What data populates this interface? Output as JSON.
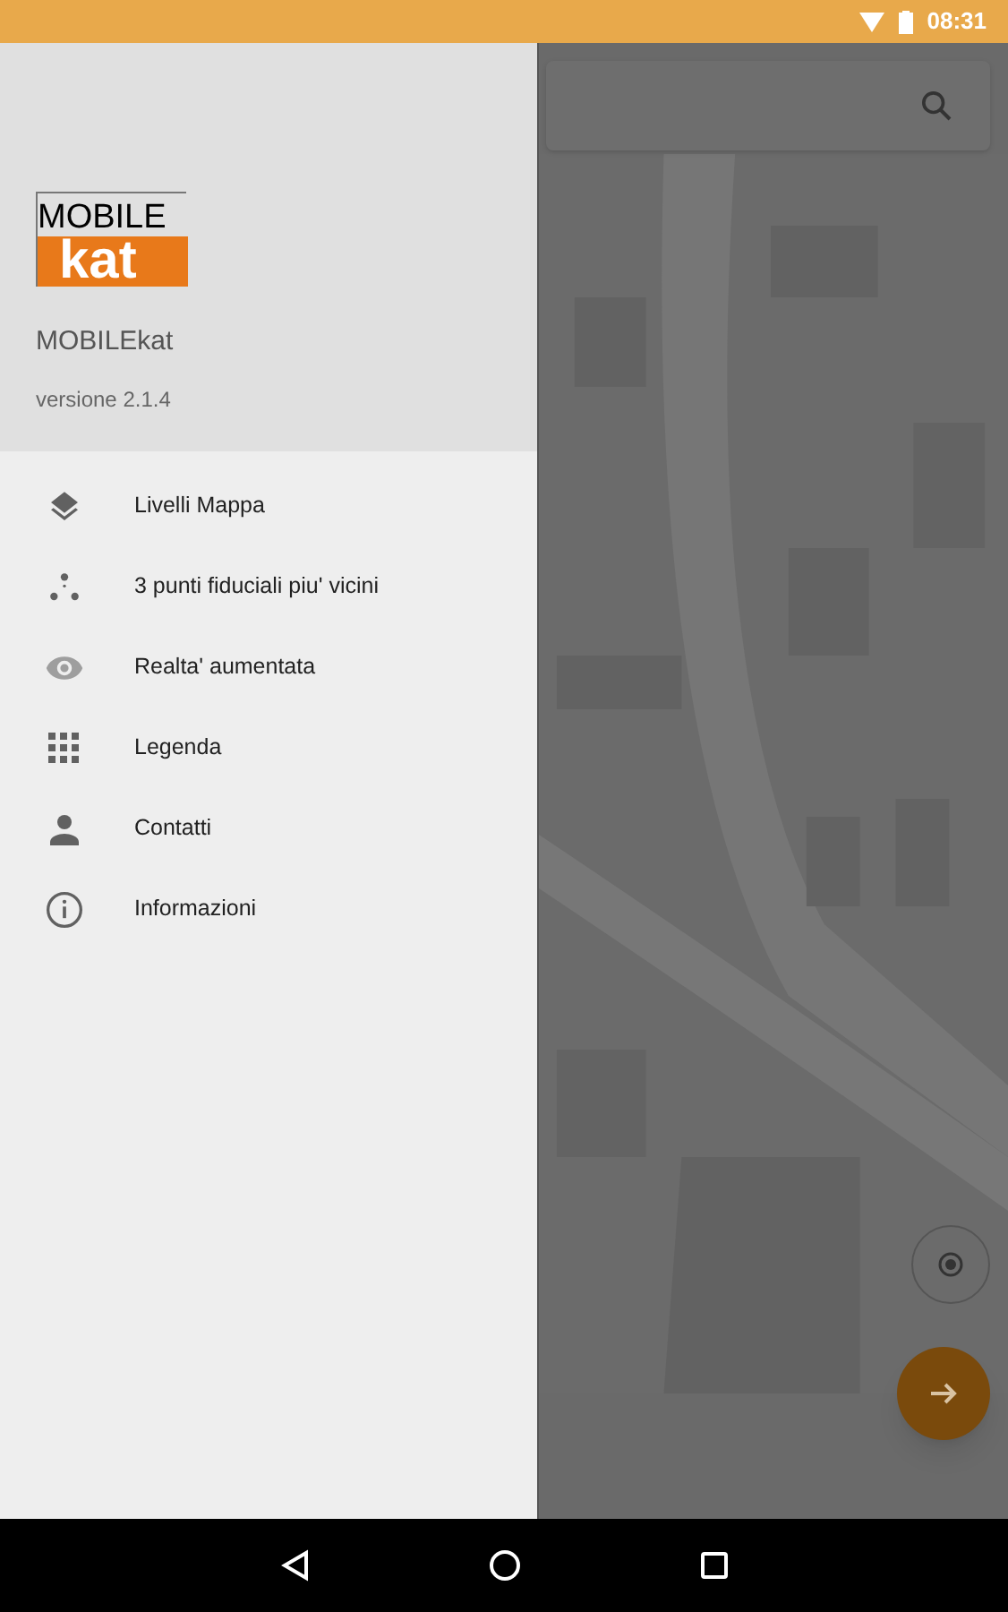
{
  "status_bar": {
    "time": "08:31"
  },
  "drawer": {
    "logo_top": "MOBILE",
    "logo_bottom": "kat",
    "app_name": "MOBILEkat",
    "version": "versione 2.1.4",
    "items": [
      {
        "kind": "layers",
        "label": "Livelli Mappa"
      },
      {
        "kind": "points",
        "label": "3 punti fiduciali piu' vicini"
      },
      {
        "kind": "eye",
        "label": "Realta' aumentata"
      },
      {
        "kind": "grid",
        "label": "Legenda"
      },
      {
        "kind": "person",
        "label": "Contatti"
      },
      {
        "kind": "info",
        "label": "Informazioni"
      }
    ]
  }
}
